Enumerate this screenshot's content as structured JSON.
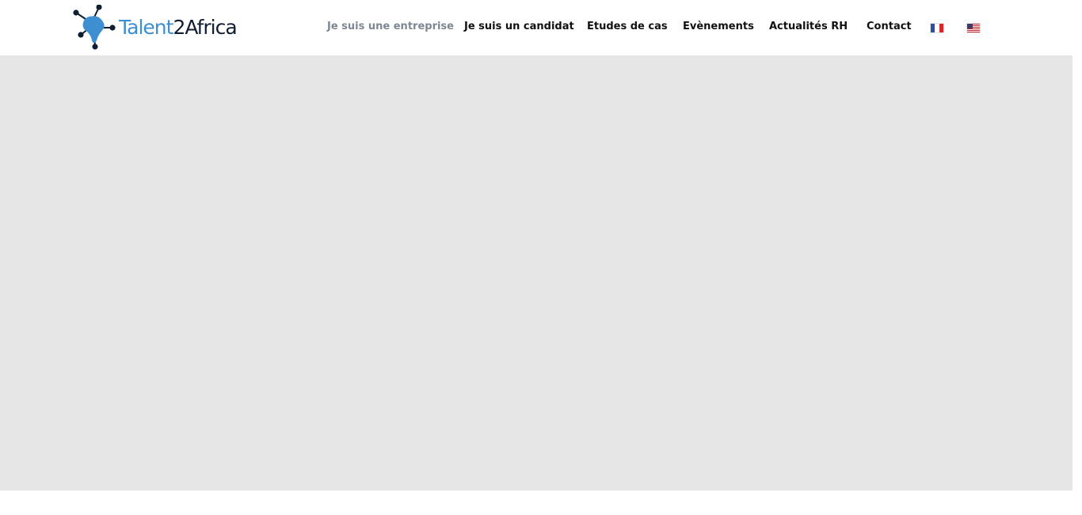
{
  "brand": {
    "name_part1": "Talent",
    "name_part2": "2Africa",
    "accent_color": "#3d8fd1",
    "dark_color": "#0f1e33"
  },
  "nav": {
    "items": [
      {
        "label": "Je suis une entreprise",
        "active": true
      },
      {
        "label": "Je suis un candidat",
        "active": false
      },
      {
        "label": "Etudes de cas",
        "active": false
      },
      {
        "label": "Evènements",
        "active": false
      },
      {
        "label": "Actualités RH",
        "active": false
      },
      {
        "label": "Contact",
        "active": false
      }
    ],
    "active_color": "#7e8793",
    "text_color": "#111111"
  },
  "languages": [
    {
      "icon": "french-flag-icon"
    },
    {
      "icon": "us-flag-icon"
    }
  ],
  "hero": {
    "background_color": "#e6e6e6"
  }
}
